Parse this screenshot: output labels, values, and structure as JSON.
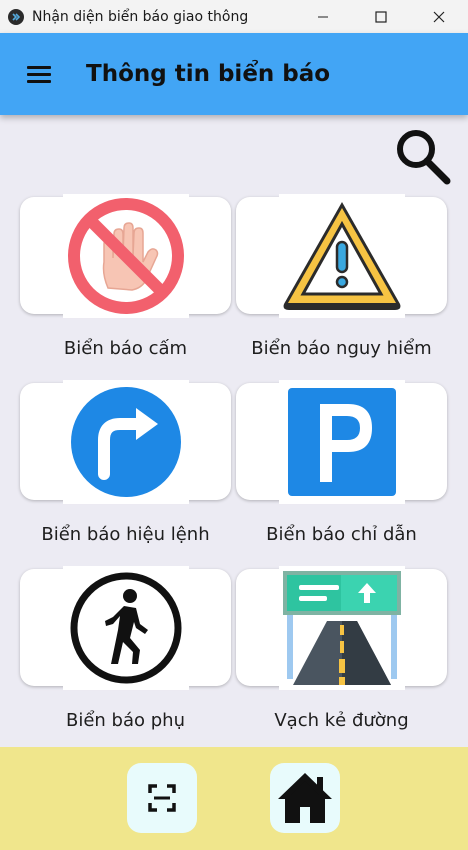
{
  "window": {
    "title": "Nhận diện biển báo giao thông"
  },
  "appbar": {
    "title": "Thông tin biển báo"
  },
  "categories": [
    {
      "label": "Biển báo cấm",
      "icon": "stop-hand-prohibition-icon"
    },
    {
      "label": "Biển báo nguy hiểm",
      "icon": "warning-triangle-icon"
    },
    {
      "label": "Biển báo hiệu lệnh",
      "icon": "turn-right-arrow-icon"
    },
    {
      "label": "Biển báo chỉ dẫn",
      "icon": "parking-icon"
    },
    {
      "label": "Biển báo phụ",
      "icon": "pedestrian-icon"
    },
    {
      "label": "Vạch kẻ đường",
      "icon": "road-marking-icon"
    }
  ],
  "colors": {
    "appbar": "#42a5f5",
    "content_bg": "#ecebf3",
    "bottombar": "#f0e68c",
    "bottom_button": "#e8fbfc"
  }
}
